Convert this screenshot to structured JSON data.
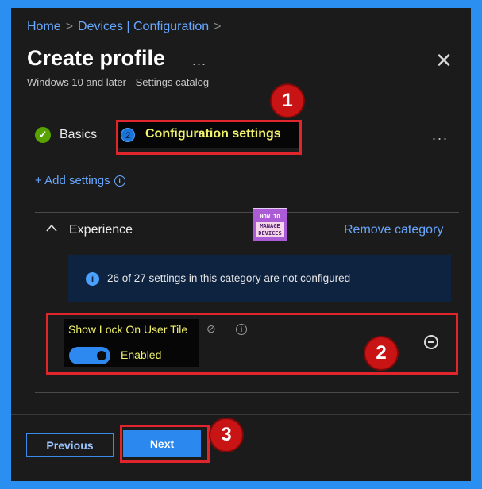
{
  "breadcrumb": {
    "home": "Home",
    "sep1": ">",
    "section": "Devices | Configuration",
    "sep2": ">"
  },
  "header": {
    "title": "Create profile",
    "more": "...",
    "close": "✕",
    "subtitle": "Windows 10 and later - Settings catalog"
  },
  "steps": {
    "basics": {
      "icon": "✓",
      "label": "Basics",
      "state": "completed"
    },
    "configuration": {
      "icon": "2",
      "label": "Configuration settings",
      "state": "current"
    },
    "more": "..."
  },
  "add_settings": {
    "label": "+ Add settings",
    "info_icon": "i"
  },
  "category": {
    "chevron": "^",
    "name": "Experience",
    "remove_label": "Remove category",
    "info_icon": "i",
    "info_text": "26 of 27 settings in this category are not configured"
  },
  "watermark": {
    "line1": "HOW TO",
    "line2": "MANAGE DEVICES"
  },
  "setting": {
    "name": "Show Lock On User Tile",
    "sync_icon": "⊘",
    "info_icon": "i",
    "toggle_on": true,
    "toggle_label": "Enabled"
  },
  "footer": {
    "previous": "Previous",
    "next": "Next"
  },
  "annotations": {
    "one": "1",
    "two": "2",
    "three": "3"
  },
  "colors": {
    "frame": "#2a8ff0",
    "panel": "#1b1b1b",
    "link": "#68a7ff",
    "highlight_text": "#f2f26c",
    "annotation_red": "#e0262c",
    "primary_button": "#2b88ee"
  },
  "icons": {
    "basics_step": "check-circle-icon",
    "configuration_step": "step-number-icon",
    "info": "info-circle-icon",
    "close": "close-icon",
    "collapse": "chevron-up-icon",
    "sync": "sync-icon",
    "remove_setting": "minus-circle-icon"
  }
}
